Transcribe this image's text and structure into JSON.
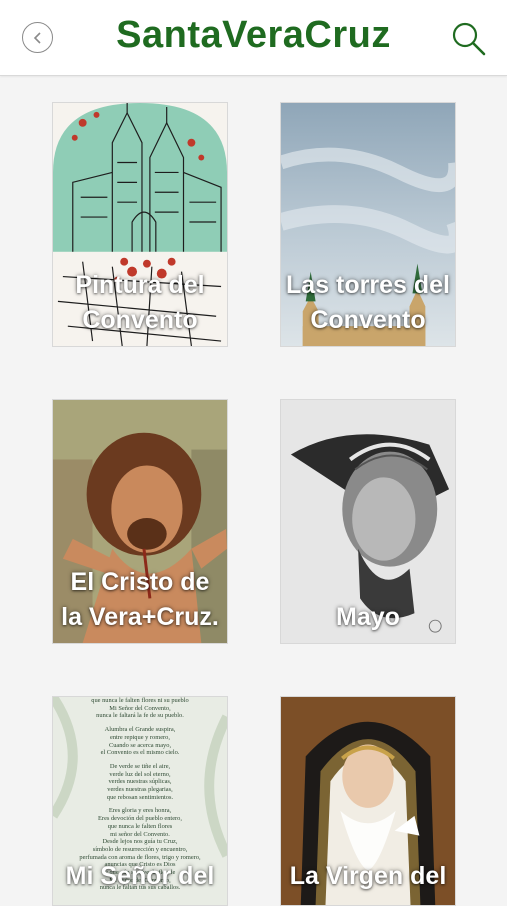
{
  "header": {
    "title": "SantaVeraCruz",
    "back_icon": "chevron-left-icon",
    "search_icon": "search-icon",
    "accent_color": "#1f6b20"
  },
  "items": [
    {
      "label": "Pintura del Convento"
    },
    {
      "label": "Las torres del Convento"
    },
    {
      "label": "El Cristo de la Vera+Cruz."
    },
    {
      "label": "Mayo"
    },
    {
      "label": "Mi Señor del"
    },
    {
      "label": "La Virgen del"
    }
  ],
  "poem_lines": [
    "que nunca le falten flores ni su pueblo",
    "Mi Señor del Convento,",
    "nunca le faltará la fe de su pueblo.",
    "Alumbra el Grande suspira,",
    "entre repique y romero,",
    "Cuando se acerca mayo,",
    "el Convento es el mismo cielo.",
    "De verde se tiñe el aire,",
    "verde luz del sol eterno,",
    "verdes nuestras súplicas,",
    "verdes nuestras plegarias,",
    "que rebosan sentimientos.",
    "Eres gloria y eres honra,",
    "Eres devoción del pueblo entero,",
    "que nunca le falten flores",
    "mi señor del Convento.",
    "Desde lejos nos guía tu Cruz,",
    "símbolo de resurrección y encuentro,",
    "perfumada con aroma de flores, trigo y romero,",
    "anuncias que Cristo es Dios",
    "y que aún se vive, la flor de",
    "Mi Señor del Convento,",
    "nunca le faltan tus sus caballos."
  ]
}
